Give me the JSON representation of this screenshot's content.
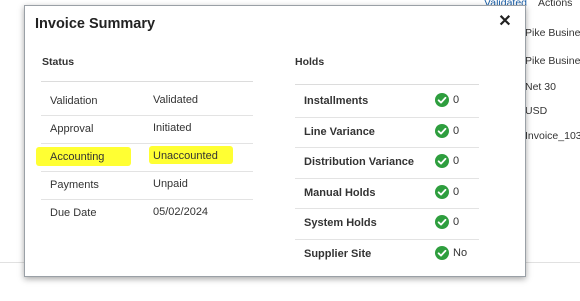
{
  "background": {
    "top_links": [
      "Validated",
      "Actions"
    ],
    "right_values": [
      "Pike Busine",
      "Pike Busine",
      "Net 30",
      "USD",
      "Invoice_103"
    ]
  },
  "dialog": {
    "title": "Invoice Summary",
    "close_icon": "close-icon",
    "status": {
      "heading": "Status",
      "rows": [
        {
          "label": "Validation",
          "value": "Validated"
        },
        {
          "label": "Approval",
          "value": "Initiated"
        },
        {
          "label": "Accounting",
          "value": "Unaccounted",
          "highlighted": true
        },
        {
          "label": "Payments",
          "value": "Unpaid"
        },
        {
          "label": "Due Date",
          "value": "05/02/2024"
        }
      ]
    },
    "holds": {
      "heading": "Holds",
      "rows": [
        {
          "label": "Installments",
          "value": "0",
          "icon": "check-circle-icon"
        },
        {
          "label": "Line Variance",
          "value": "0",
          "icon": "check-circle-icon"
        },
        {
          "label": "Distribution Variance",
          "value": "0",
          "icon": "check-circle-icon"
        },
        {
          "label": "Manual Holds",
          "value": "0",
          "icon": "check-circle-icon"
        },
        {
          "label": "System Holds",
          "value": "0",
          "icon": "check-circle-icon"
        },
        {
          "label": "Supplier Site",
          "value": "No",
          "icon": "check-circle-icon"
        }
      ]
    }
  },
  "colors": {
    "highlight": "#ffff33",
    "check_green": "#2e9e3e",
    "link_blue": "#1a5fa8"
  }
}
